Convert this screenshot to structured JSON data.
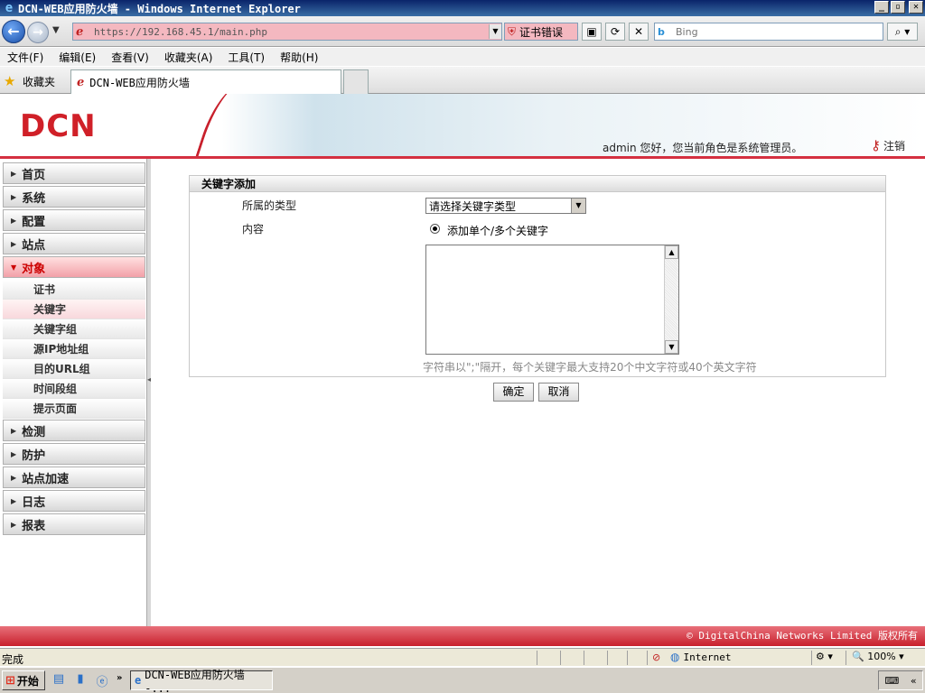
{
  "window": {
    "title": "DCN-WEB应用防火墙 - Windows Internet Explorer",
    "controls": [
      "_",
      "▫",
      "✕"
    ]
  },
  "browser": {
    "url": "https://192.168.45.1/main.php",
    "cert_error": "证书错误",
    "search_placeholder": "Bing",
    "menu": [
      "文件(F)",
      "编辑(E)",
      "查看(V)",
      "收藏夹(A)",
      "工具(T)",
      "帮助(H)"
    ],
    "favorites_label": "收藏夹",
    "tab_title": "DCN-WEB应用防火墙",
    "status_text": "完成",
    "zone": "Internet",
    "zoom": "100%"
  },
  "app": {
    "logo": "DCN",
    "welcome": "admin 您好，您当前角色是系统管理员。",
    "logout": "注销",
    "footer": "© DigitalChina Networks Limited 版权所有",
    "colors": {
      "brand_red": "#d02028",
      "footer_red": "#c8202c"
    }
  },
  "sidebar": {
    "items": [
      {
        "label": "首页"
      },
      {
        "label": "系统"
      },
      {
        "label": "配置"
      },
      {
        "label": "站点"
      },
      {
        "label": "对象"
      },
      {
        "label": "检测"
      },
      {
        "label": "防护"
      },
      {
        "label": "站点加速"
      },
      {
        "label": "日志"
      },
      {
        "label": "报表"
      }
    ],
    "active_item": "对象",
    "subitems": [
      "证书",
      "关键字",
      "关键字组",
      "源IP地址组",
      "目的URL组",
      "时间段组",
      "提示页面"
    ],
    "active_subitem": "关键字"
  },
  "form": {
    "title": "关键字添加",
    "type_label": "所属的类型",
    "type_value": "请选择关键字类型",
    "content_label": "内容",
    "radio_label": "添加单个/多个关键字",
    "hint": "字符串以\";\"隔开，每个关键字最大支持20个中文字符或40个英文字符",
    "confirm": "确定",
    "cancel": "取消"
  },
  "taskbar": {
    "start": "开始",
    "task_title": "DCN-WEB应用防火墙 -..."
  }
}
